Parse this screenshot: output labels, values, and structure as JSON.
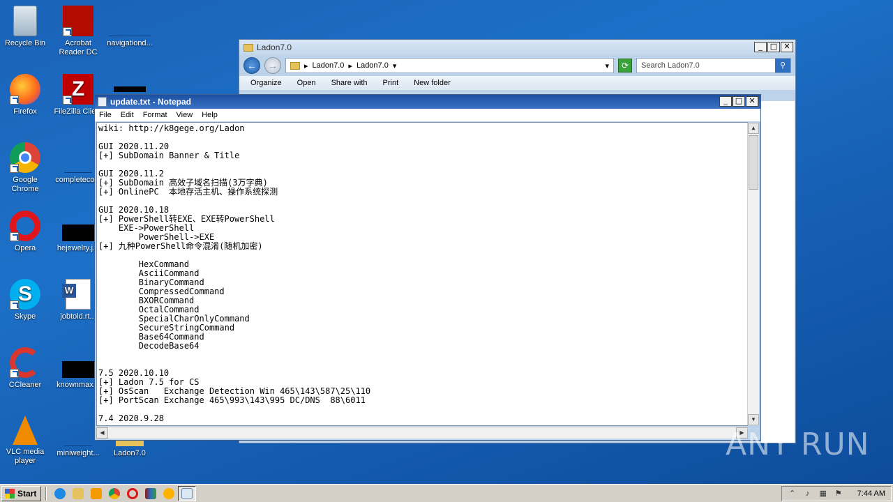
{
  "desktop": {
    "icons": [
      {
        "label": "Recycle Bin"
      },
      {
        "label": "Acrobat Reader DC"
      },
      {
        "label": "navigationd..."
      },
      {
        "label": "Firefox"
      },
      {
        "label": "FileZilla Clie..."
      },
      {
        "label": "Google Chrome"
      },
      {
        "label": "completeco..."
      },
      {
        "label": "Opera"
      },
      {
        "label": "hejewelry.j..."
      },
      {
        "label": "Skype"
      },
      {
        "label": "jobtold.rt..."
      },
      {
        "label": "CCleaner"
      },
      {
        "label": "knownmax..."
      },
      {
        "label": "VLC media player"
      },
      {
        "label": "miniweight..."
      },
      {
        "label": "Ladon7.0"
      }
    ]
  },
  "explorer": {
    "title": "Ladon7.0",
    "breadcrumb": [
      "Ladon7.0",
      "Ladon7.0"
    ],
    "search_placeholder": "Search Ladon7.0",
    "commands": [
      "Organize",
      "Open",
      "Share with",
      "Print",
      "New folder"
    ]
  },
  "notepad": {
    "title": "update.txt - Notepad",
    "menu": [
      "File",
      "Edit",
      "Format",
      "View",
      "Help"
    ],
    "content": "wiki: http://k8gege.org/Ladon\n\nGUI 2020.11.20\n[+] SubDomain Banner & Title\n\nGUI 2020.11.2\n[+] SubDomain 高效子域名扫描(3万字典)\n[+] OnlinePC  本地存活主机、操作系统探测\n\nGUI 2020.10.18\n[+] PowerShell转EXE、EXE转PowerShell\n    EXE->PowerShell\n        PowerShell->EXE\n[+] 九种PowerShell命令混淆(随机加密)\n\n        HexCommand\n        AsciiCommand\n        BinaryCommand\n        CompressedCommand\n        BXORCommand\n        OctalCommand\n        SpecialCharOnlyCommand\n        SecureStringCommand\n        Base64Command\n        DecodeBase64\n\n\n7.5 2020.10.10\n[+] Ladon 7.5 for CS\n[+] OsScan   Exchange Detection Win 465\\143\\587\\25\\110\n[+] PortScan Exchange 465\\993\\143\\995 DC/DNS  88\\6011\n\n7.4 2020.9.28"
  },
  "watermark": "ANY RUN",
  "taskbar": {
    "start_label": "Start",
    "clock": "7:44 AM"
  }
}
